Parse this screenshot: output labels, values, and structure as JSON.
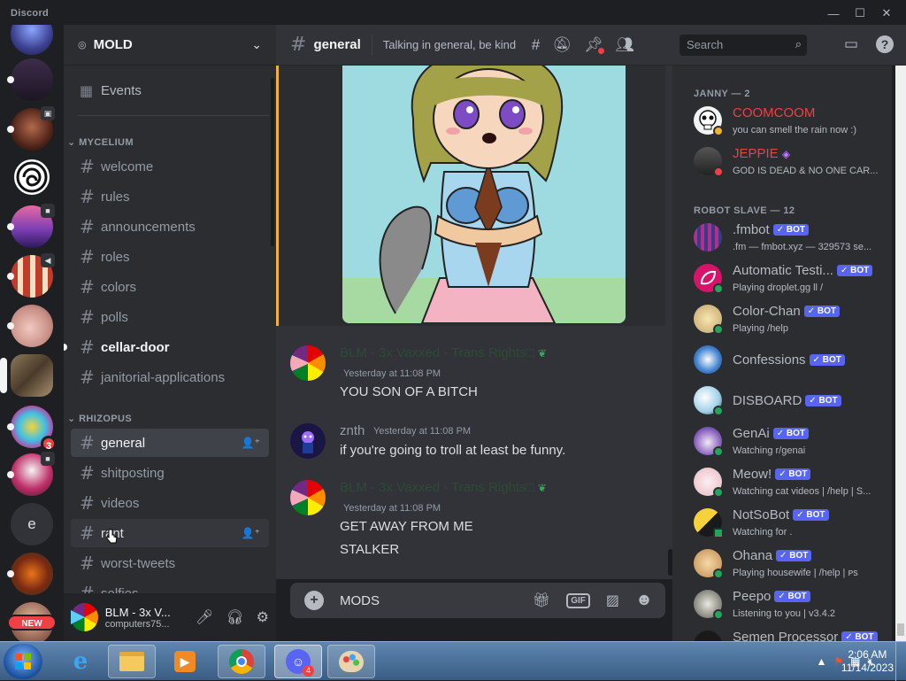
{
  "app": {
    "title": "Discord"
  },
  "window": {
    "minimize": "—",
    "maximize": "☐",
    "close": "✕"
  },
  "rail": {
    "new_badge": "NEW",
    "badge_3": "3",
    "letter_e": "e"
  },
  "guild": {
    "name": "MOLD"
  },
  "sidebar": {
    "events": "Events",
    "categories": {
      "c1": "MYCELIUM",
      "c2": "RHIZOPUS"
    },
    "channels": [
      {
        "label": "welcome"
      },
      {
        "label": "rules"
      },
      {
        "label": "announcements"
      },
      {
        "label": "roles"
      },
      {
        "label": "colors"
      },
      {
        "label": "polls"
      },
      {
        "label": "cellar-door"
      },
      {
        "label": "janitorial-applications"
      },
      {
        "label": "general"
      },
      {
        "label": "shitposting"
      },
      {
        "label": "videos"
      },
      {
        "label": "rant"
      },
      {
        "label": "worst-tweets"
      },
      {
        "label": "selfies"
      }
    ]
  },
  "user": {
    "name": "BLM - 3x V...",
    "tag": "computers75..."
  },
  "header": {
    "channel": "general",
    "topic": "Talking in general, be kind",
    "search_placeholder": "Search"
  },
  "messages": [
    {
      "author": "BLM - 3x Vaxxed - Trans Rights□",
      "time": "Yesterday at 11:08 PM",
      "lines": [
        "YOU SON OF A BITCH"
      ]
    },
    {
      "author": "znth",
      "time": "Yesterday at 11:08 PM",
      "lines": [
        "if you're going to troll at least be funny."
      ]
    },
    {
      "author": "BLM - 3x Vaxxed - Trans Rights□",
      "time": "Yesterday at 11:08 PM",
      "lines": [
        "GET AWAY FROM ME",
        "STALKER"
      ]
    }
  ],
  "composer": {
    "value": "MODS",
    "gif_label": "GIF"
  },
  "members": {
    "groups": [
      {
        "title": "JANNY — 2"
      },
      {
        "title": "ROBOT SLAVE — 12"
      }
    ],
    "list": [
      {
        "name": "COOMCOOM",
        "status": "you can smell the rain now :)",
        "color": "#f23f43"
      },
      {
        "name": "JEPPIE",
        "status": "GOD IS DEAD & NO ONE CAR...",
        "color": "#f23f43"
      },
      {
        "name": ".fmbot",
        "status": ".fm — fmbot.xyz — 329573 se...",
        "bot": "BOT"
      },
      {
        "name": "Automatic Testi...",
        "status": "Playing droplet.gg ll /",
        "bot": "BOT"
      },
      {
        "name": "Color-Chan",
        "status": "Playing /help",
        "bot": "BOT"
      },
      {
        "name": "Confessions",
        "status": "",
        "bot": "BOT"
      },
      {
        "name": "DISBOARD",
        "status": "",
        "bot": "BOT"
      },
      {
        "name": "GenAi",
        "status": "Watching r/genai",
        "bot": "BOT"
      },
      {
        "name": "Meow!",
        "status": "Watching cat videos | /help | S...",
        "bot": "BOT"
      },
      {
        "name": "NotSoBot",
        "status": "Watching for .",
        "bot": "BOT"
      },
      {
        "name": "Ohana",
        "status": "Playing housewife | /help | ᴘs",
        "bot": "BOT"
      },
      {
        "name": "Peepo",
        "status": "Listening to you | v3.4.2",
        "bot": "BOT"
      },
      {
        "name": "Semen Processor",
        "status": "",
        "bot": "BOT"
      }
    ]
  },
  "taskbar": {
    "time": "2:06 AM",
    "date": "11/14/2023",
    "discord_badge": "4"
  },
  "colors": {
    "accent": "#5865f2",
    "danger": "#f23f43",
    "online": "#23a55a"
  }
}
